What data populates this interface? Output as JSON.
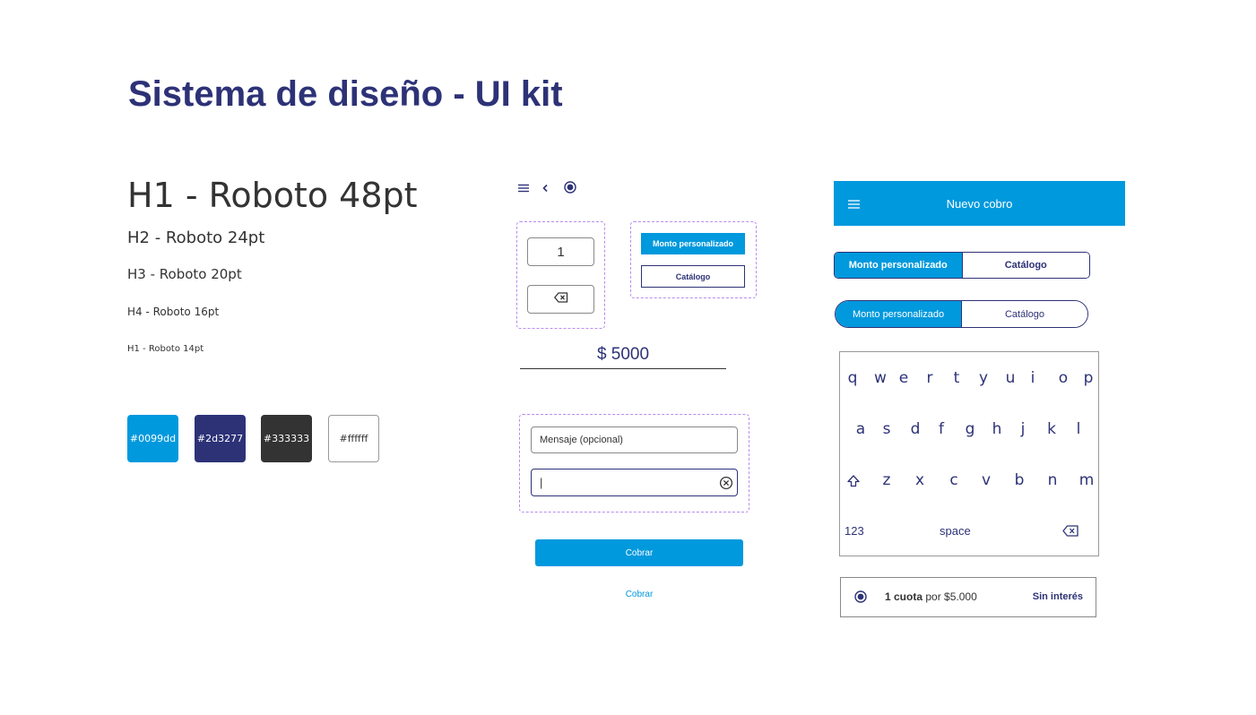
{
  "page": {
    "title": "Sistema de diseño - UI kit"
  },
  "typography": {
    "h1": "H1 - Roboto 48pt",
    "h2": "H2  - Roboto 24pt",
    "h3": "H3 -  Roboto 20pt",
    "h4": "H4 - Roboto 16pt",
    "h5": "H1 - Roboto 14pt"
  },
  "swatches": [
    {
      "hex": "#0099dd",
      "label": "#0099dd"
    },
    {
      "hex": "#2d3277",
      "label": "#2d3277"
    },
    {
      "hex": "#333333",
      "label": "#333333"
    },
    {
      "hex": "#ffffff",
      "label": "#ffffff"
    }
  ],
  "icons": {
    "menu": "menu-icon",
    "back": "chevron-left-icon",
    "radio": "radio-selected-icon",
    "backspace": "backspace-icon",
    "clear": "clear-circle-icon",
    "shift": "shift-icon"
  },
  "components": {
    "stepper_value": "1",
    "btn_monto_small": "Monto personalizado",
    "btn_catalogo_small": "Catálogo",
    "amount": "$ 5000",
    "message_placeholder": "Mensaje (opcional)",
    "text_field_value": "|",
    "cobrar_primary": "Cobrar",
    "cobrar_link": "Cobrar"
  },
  "app_bar": {
    "title": "Nuevo cobro"
  },
  "segmented": {
    "option_a": "Monto personalizado",
    "option_b": "Catálogo"
  },
  "keyboard": {
    "row1": [
      "q",
      "w",
      "e",
      "r",
      "t",
      "y",
      "u",
      "i",
      "o",
      "p"
    ],
    "row2": [
      "a",
      "s",
      "d",
      "f",
      "g",
      "h",
      "j",
      "k",
      "l"
    ],
    "row3": [
      "z",
      "x",
      "c",
      "v",
      "b",
      "n",
      "m"
    ],
    "numbers_key": "123",
    "space_key": "space"
  },
  "installment": {
    "count": "1 cuota",
    "text": "por $5.000",
    "tag": "Sin interés"
  },
  "colors": {
    "primary": "#0099dd",
    "navy": "#2d3277",
    "text": "#333333",
    "white": "#ffffff",
    "dashed_outline": "#b98cf0"
  }
}
